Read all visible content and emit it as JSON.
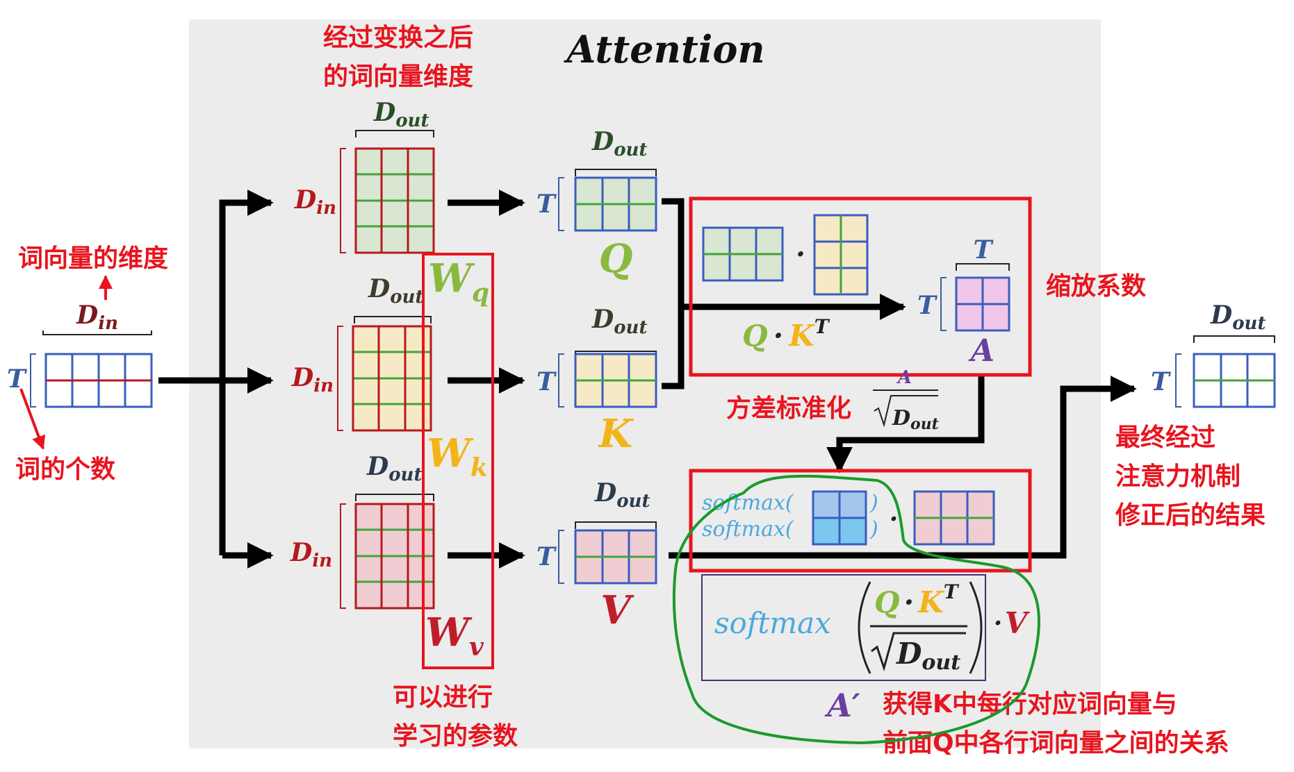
{
  "title": "Attention",
  "colors": {
    "panel": "#ececec",
    "arrow": "#000000",
    "annotation": "#e8141e",
    "red_box": "#e8141e",
    "green_outline": "#1a9a2c",
    "grid_blue": "#3a5dbf",
    "grid_green": "#43a33a",
    "grid_red": "#b5191d",
    "fill_green": "#d8e6d2",
    "fill_yellow": "#f6e9c5",
    "fill_pink": "#efcdd2",
    "fill_lilac": "#f0c6ea",
    "fill_cyan": "#7cc7ee",
    "q_green": "#8ab940",
    "k_gold": "#f2b418",
    "v_red": "#c01d2b",
    "a_purple": "#6a3f9e",
    "axis_blue": "#3a5d9f",
    "softmax_blue": "#4ba9dd"
  },
  "labels": {
    "d_main": "D",
    "sub_in": "in",
    "sub_out": "out",
    "t": "T",
    "w_main": "W",
    "wq_sub": "q",
    "wk_sub": "k",
    "wv_sub": "v",
    "q": "Q",
    "k": "K",
    "v": "V",
    "a": "A",
    "a_prime": "A′",
    "dot": "·",
    "kt_sup": "T",
    "softmax": "softmax(",
    "close_paren": ")",
    "softmax_word": "softmax"
  },
  "annotations": {
    "after_transform_1": "经过变换之后",
    "after_transform_2": "的词向量维度",
    "word_vec_dim": "词向量的维度",
    "word_count": "词的个数",
    "learnable_1": "可以进行",
    "learnable_2": "学习的参数",
    "scale_factor": "缩放系数",
    "variance_norm": "方差标准化",
    "final_1": "最终经过",
    "final_2": "注意力机制",
    "final_3": "修正后的结果",
    "relation_1": "获得K中每行对应词向量与",
    "relation_2": "前面Q中各行词向量之间的关系"
  }
}
